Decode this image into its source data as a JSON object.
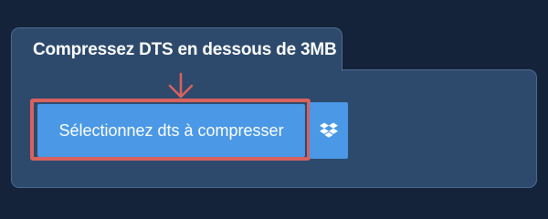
{
  "panel": {
    "title": "Compressez DTS en dessous de 3MB"
  },
  "buttons": {
    "select_label": "Sélectionnez dts à compresser",
    "dropbox_icon": "dropbox-icon"
  },
  "colors": {
    "background": "#142339",
    "panel": "#2d4a6c",
    "button": "#4a98e6",
    "highlight": "#d9615e"
  }
}
